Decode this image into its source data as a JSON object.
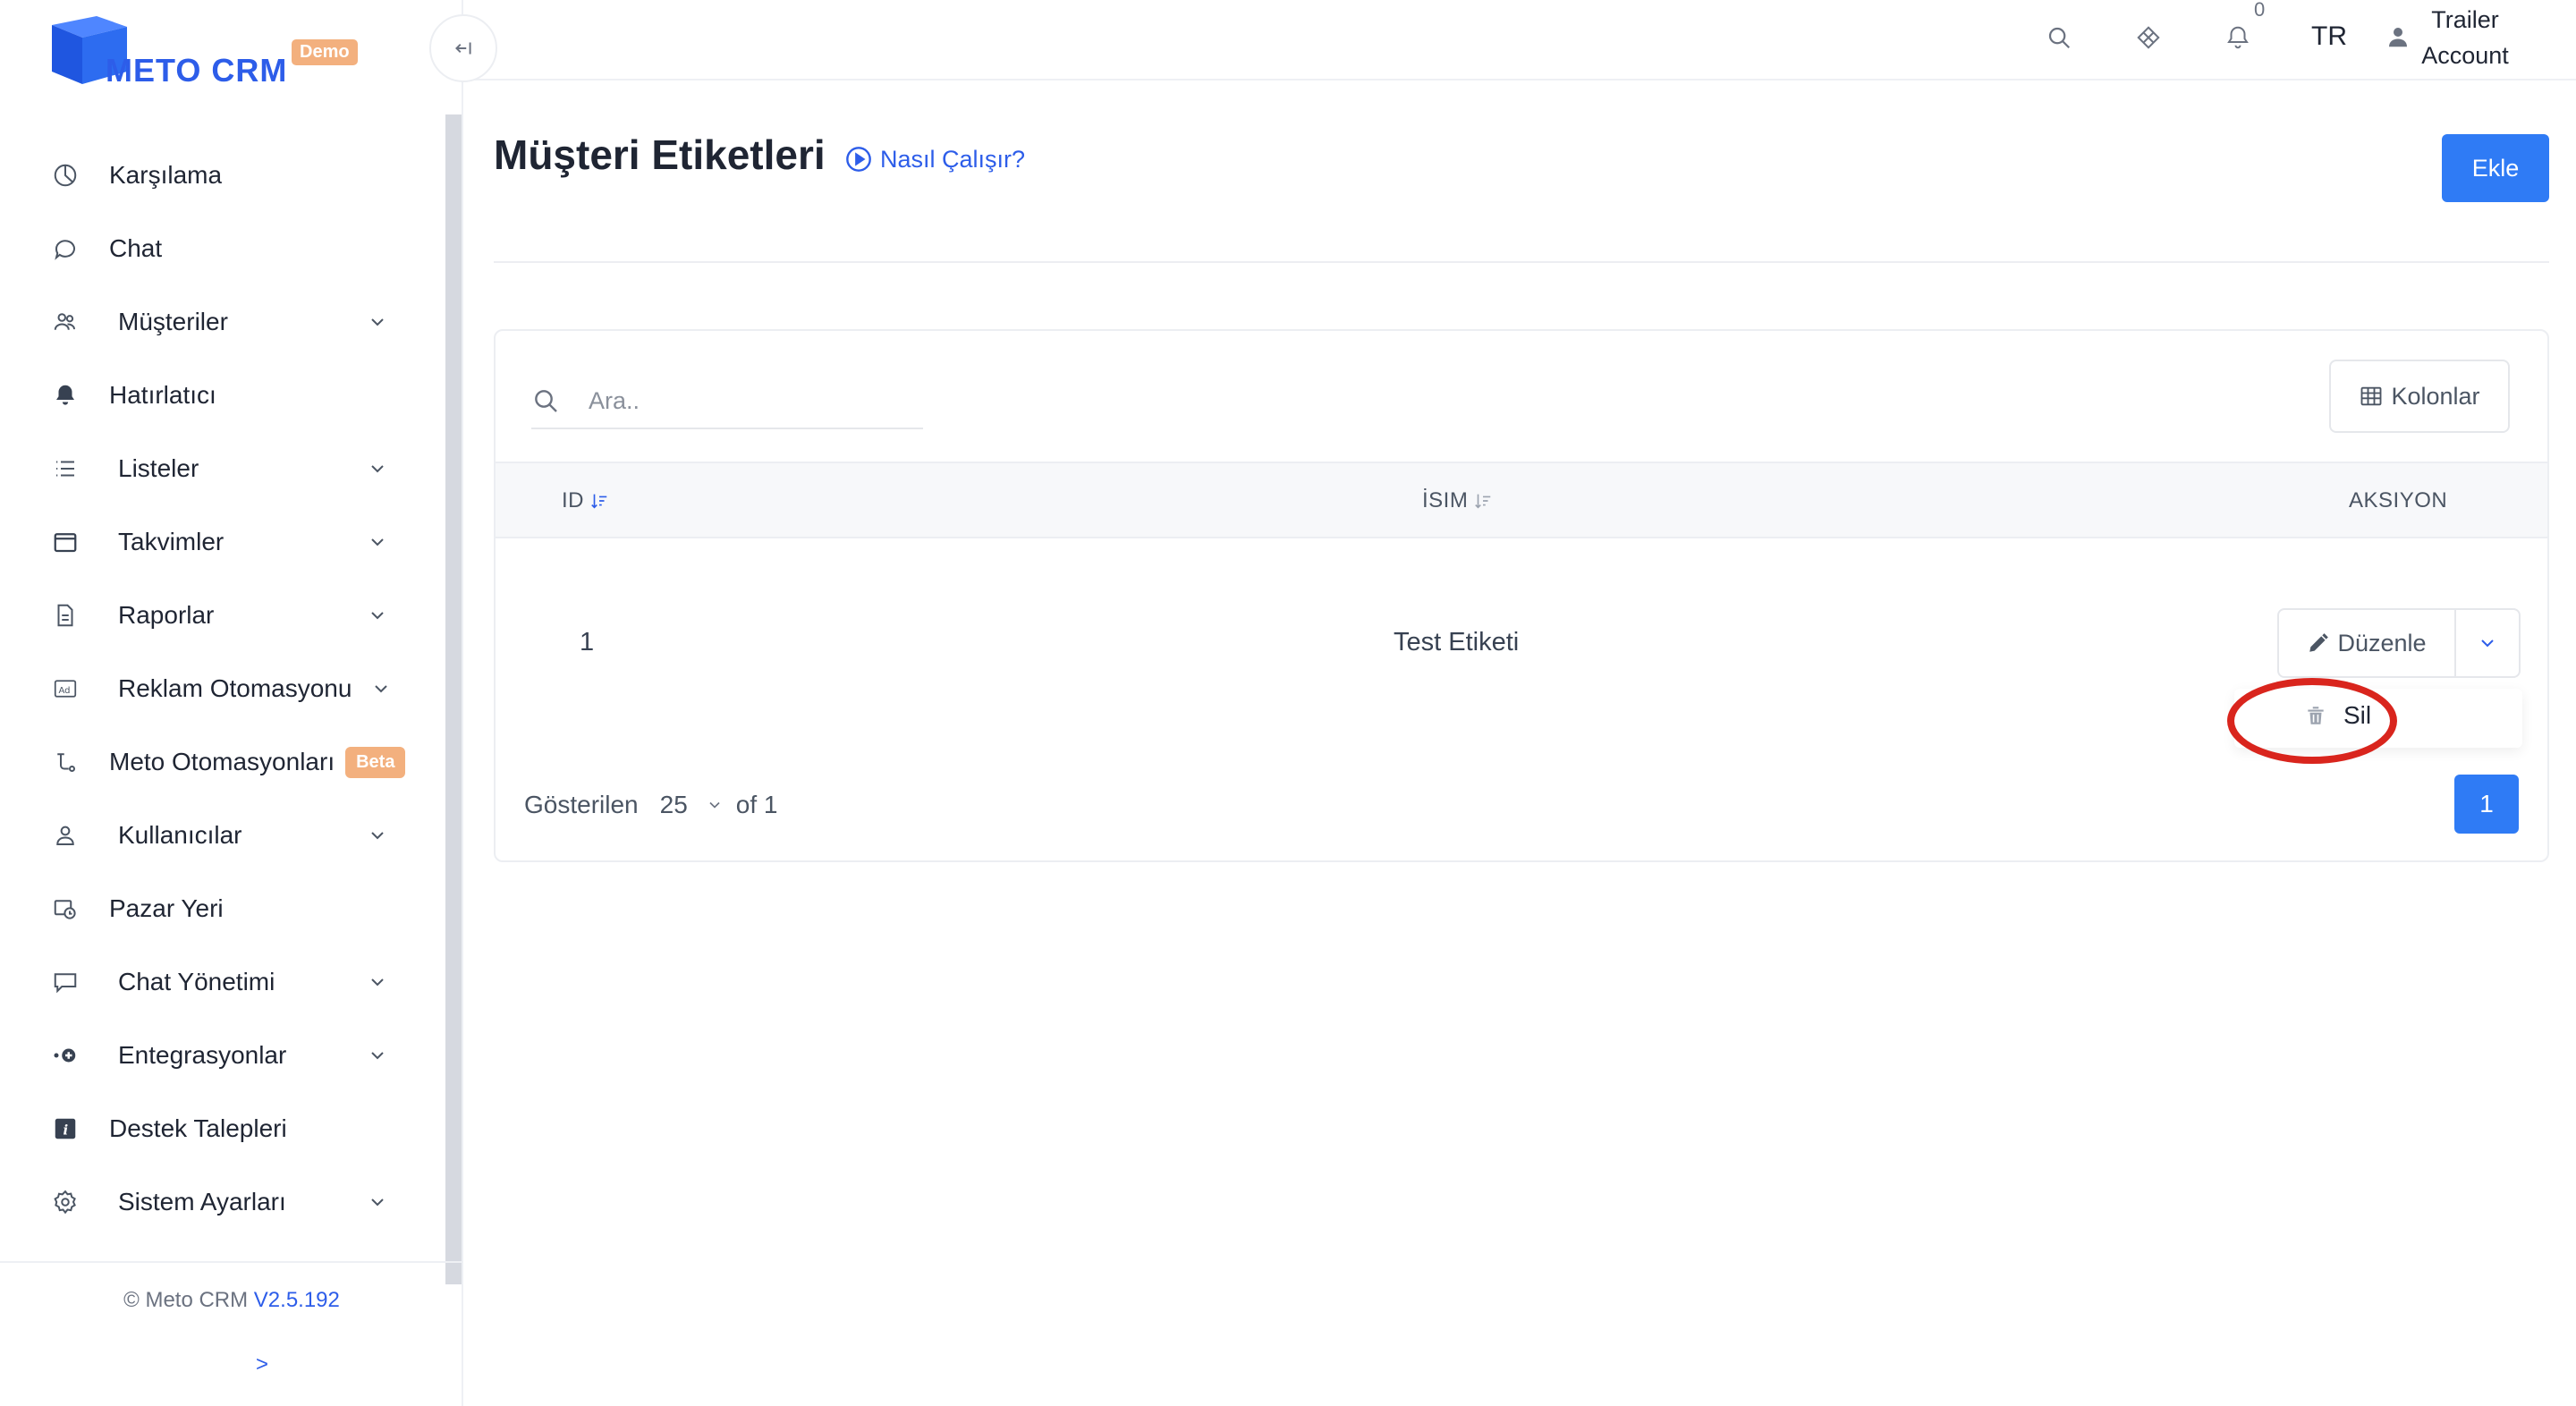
{
  "brand": {
    "name": "METO CRM",
    "badge": "Demo",
    "color": "#2d5de9"
  },
  "sidebar": {
    "items": [
      {
        "label": "Karşılama",
        "icon": "pie-chart-icon",
        "has_submenu": false
      },
      {
        "label": "Chat",
        "icon": "chat-bubble-icon",
        "has_submenu": false
      },
      {
        "label": "Müşteriler",
        "icon": "users-icon",
        "has_submenu": true
      },
      {
        "label": "Hatırlatıcı",
        "icon": "bell-icon",
        "has_submenu": false
      },
      {
        "label": "Listeler",
        "icon": "list-icon",
        "has_submenu": true
      },
      {
        "label": "Takvimler",
        "icon": "calendar-icon",
        "has_submenu": true
      },
      {
        "label": "Raporlar",
        "icon": "document-icon",
        "has_submenu": true
      },
      {
        "label": "Reklam Otomasyonu",
        "icon": "ad-icon",
        "has_submenu": true
      },
      {
        "label": "Meto Otomasyonları",
        "icon": "flow-icon",
        "has_submenu": false,
        "badge": "Beta"
      },
      {
        "label": "Kullanıcılar",
        "icon": "user-icon",
        "has_submenu": true
      },
      {
        "label": "Pazar Yeri",
        "icon": "marketplace-icon",
        "has_submenu": false
      },
      {
        "label": "Chat Yönetimi",
        "icon": "chat-settings-icon",
        "has_submenu": true
      },
      {
        "label": "Entegrasyonlar",
        "icon": "integration-icon",
        "has_submenu": true
      },
      {
        "label": "Destek Talepleri",
        "icon": "info-icon",
        "has_submenu": false
      },
      {
        "label": "Sistem Ayarları",
        "icon": "gear-icon",
        "has_submenu": true
      }
    ],
    "footer": {
      "copyright": "© Meto CRM",
      "version": "V2.5.192",
      "expand": ">"
    }
  },
  "topbar": {
    "notification_count": "0",
    "language": "TR",
    "user_line1": "Trailer",
    "user_line2": "Account"
  },
  "page": {
    "title": "Müşteri Etiketleri",
    "how_link": "Nasıl Çalışır?",
    "add_button": "Ekle"
  },
  "table": {
    "search_placeholder": "Ara..",
    "columns_button": "Kolonlar",
    "headers": {
      "id": "ID",
      "name": "İSIM",
      "action": "AKSIYON"
    },
    "rows": [
      {
        "id": "1",
        "name": "Test Etiketi"
      }
    ],
    "edit_label": "Düzenle",
    "dropdown": {
      "delete_label": "Sil"
    },
    "footer": {
      "showing": "Gösterilen",
      "page_size": "25",
      "of": "of 1",
      "current_page": "1"
    }
  },
  "colors": {
    "primary": "#2f7bf5",
    "highlight": "#d9251d",
    "beta_badge": "#f3b07e"
  }
}
